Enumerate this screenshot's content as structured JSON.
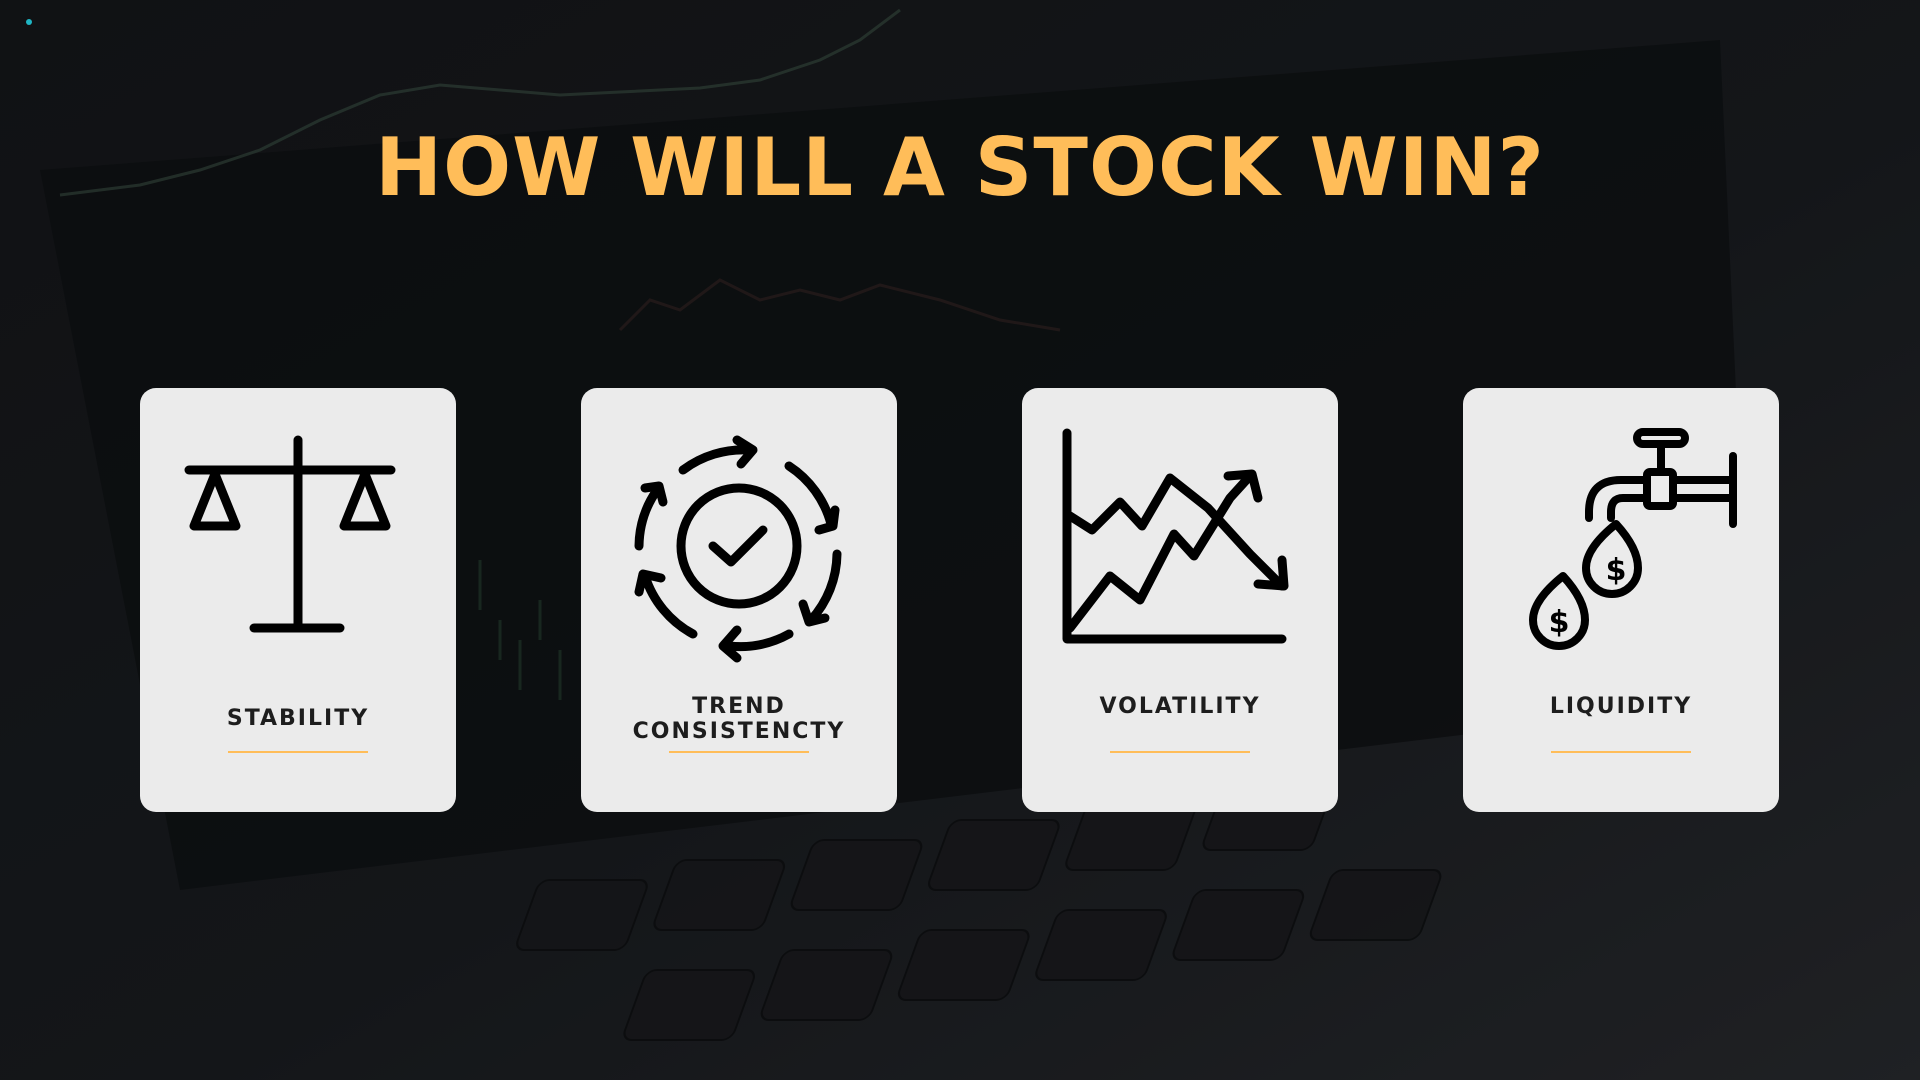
{
  "slide": {
    "title": "HOW WILL A STOCK WIN?",
    "accent_color": "#ffbd59",
    "card_color": "#ebebeb",
    "background_color": "#141618"
  },
  "cards": [
    {
      "label_lines": [
        "STABILITY"
      ],
      "icon": "balance-scale-icon"
    },
    {
      "label_lines": [
        "TREND",
        "CONSISTENCTY"
      ],
      "icon": "circular-arrows-check-icon"
    },
    {
      "label_lines": [
        "VOLATILITY"
      ],
      "icon": "volatile-chart-icon"
    },
    {
      "label_lines": [
        "LIQUIDITY"
      ],
      "icon": "faucet-money-drops-icon"
    }
  ]
}
